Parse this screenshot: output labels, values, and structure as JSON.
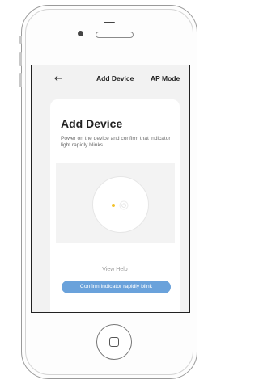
{
  "app_bar": {
    "title": "Add Device",
    "action_label": "AP Mode",
    "back_icon": "arrow-left-icon"
  },
  "card": {
    "title": "Add Device",
    "description": "Power on the device and confirm that indicator light rapidly blinks",
    "illustration": {
      "indicator_color": "#f2c22b",
      "power_icon": "power-icon"
    },
    "help_link": "View Help",
    "confirm_button": "Confirm indicator rapidly blink"
  },
  "colors": {
    "accent": "#6aa2db",
    "screen_background": "#f2f2f2",
    "card_background": "#ffffff"
  }
}
